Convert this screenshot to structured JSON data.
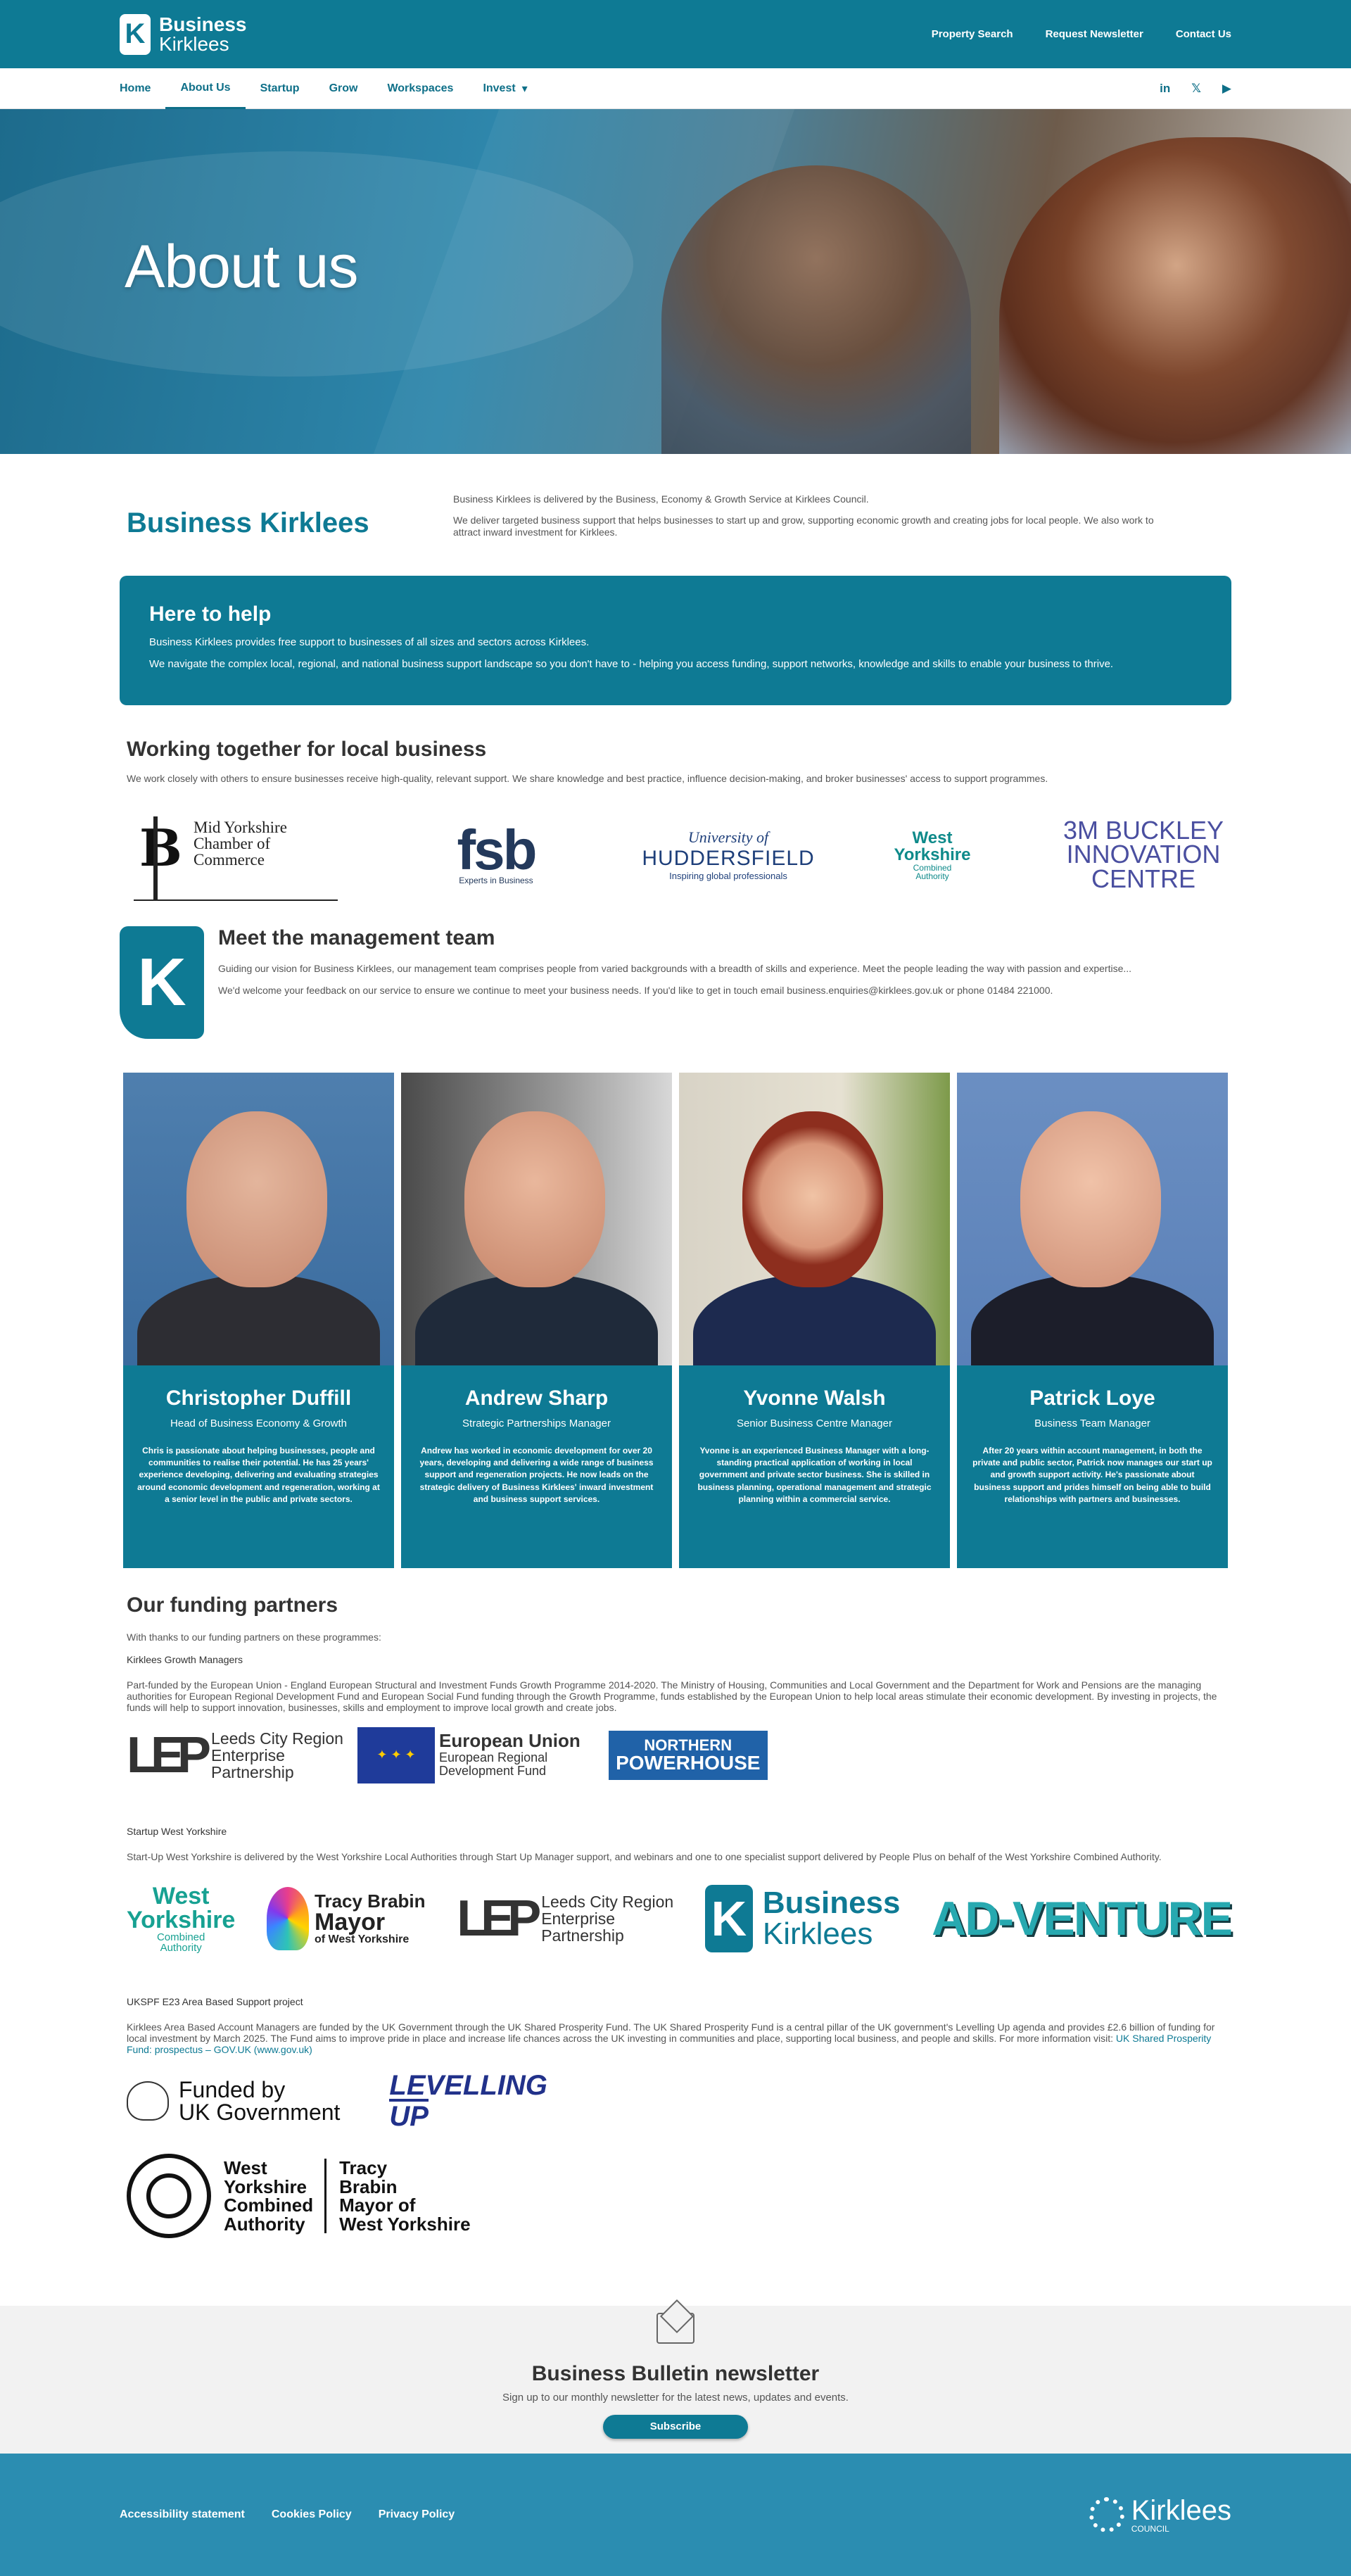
{
  "brand": {
    "line1": "Business",
    "line2": "Kirklees"
  },
  "top_links": [
    "Property Search",
    "Request Newsletter",
    "Contact Us"
  ],
  "nav": [
    "Home",
    "About Us",
    "Startup",
    "Grow",
    "Workspaces",
    "Invest"
  ],
  "nav_active": "About Us",
  "social": [
    "in",
    "𝕏",
    "▶"
  ],
  "hero": {
    "title": "About us"
  },
  "intro": {
    "heading": "Business Kirklees",
    "p1": "Business Kirklees is delivered by the Business, Economy & Growth Service at Kirklees Council.",
    "p2": "We deliver targeted business support that helps businesses to start up and grow, supporting economic growth and creating jobs for local people. We also work to attract inward investment for Kirklees."
  },
  "help": {
    "heading": "Here to help",
    "p1": "Business Kirklees provides free support to businesses of all sizes and sectors across Kirklees.",
    "p2": "We navigate the complex local, regional, and national business support landscape so you don't have to - helping you access funding, support networks, knowledge and skills to enable your business to thrive."
  },
  "working": {
    "heading": "Working together for local business",
    "text": "We work closely with others to ensure businesses receive high-quality, relevant support. We share knowledge and best practice, influence decision-making, and broker businesses' access to support programmes.",
    "logos": {
      "myc_line1": "Mid Yorkshire",
      "myc_line2": "Chamber of Commerce",
      "fsb": "fsb",
      "fsb_sub": "Experts in Business",
      "hud_a": "University of",
      "hud_b": "HUDDERSFIELD",
      "hud_c": "Inspiring global professionals",
      "wy_a": "West",
      "wy_b": "Yorkshire",
      "wy_c": "Combined",
      "wy_d": "Authority",
      "bk_a": "3M BUCKLEY",
      "bk_b": "INNOVATION",
      "bk_c": "CENTRE"
    }
  },
  "mgmt": {
    "heading": "Meet the management team",
    "p1": "Guiding our vision for Business Kirklees, our management team comprises people from varied backgrounds with a breadth of skills and experience. Meet the people leading the way with passion and expertise...",
    "p2": "We'd welcome your feedback on our service to ensure we continue to meet your business needs. If you'd like to get in touch email business.enquiries@kirklees.gov.uk or phone 01484 221000."
  },
  "team": [
    {
      "name": "Christopher Duffill",
      "role": "Head of Business Economy & Growth",
      "bio": "Chris is passionate about helping businesses, people and communities to realise their potential.  He has 25 years' experience developing, delivering and evaluating strategies around economic development and regeneration, working at a senior level in the public and private sectors."
    },
    {
      "name": "Andrew Sharp",
      "role": "Strategic Partnerships Manager",
      "bio": "Andrew has worked in economic development for over 20 years, developing and delivering a wide range of business support and regeneration projects. He now leads on the strategic delivery of Business Kirklees' inward investment and business support services."
    },
    {
      "name": "Yvonne Walsh",
      "role": "Senior Business Centre Manager",
      "bio": "Yvonne is an experienced Business Manager with a long-standing practical application of working in local government and private sector business. She is skilled in business planning, operational management and strategic planning within a commercial service."
    },
    {
      "name": "Patrick Loye",
      "role": "Business Team Manager",
      "bio": "After 20 years within account management, in both the private and public sector, Patrick now manages our start up and growth support activity. He's passionate about business support and prides himself on being able to build relationships with partners and businesses."
    }
  ],
  "funding": {
    "heading": "Our funding partners",
    "lead": "With thanks to our funding partners on these programmes:",
    "s1_title": "Kirklees Growth Managers",
    "s1_text": "Part-funded by the European Union - England European Structural and Investment Funds Growth Programme 2014-2020. The Ministry of Housing, Communities and Local Government and the Department for Work and Pensions are the managing authorities for European Regional Development Fund and European Social Fund funding through the Growth Programme, funds established by the European Union to help local areas stimulate their economic development. By investing in projects, the funds will help to support innovation, businesses, skills and employment to improve local growth and create jobs.",
    "lep_a": "Leeds City Region",
    "lep_b": "Enterprise",
    "lep_c": "Partnership",
    "eu_a": "European Union",
    "eu_b": "European Regional",
    "eu_c": "Development Fund",
    "np_a": "NORTHERN",
    "np_b": "POWERHOUSE",
    "s2_title": "Startup West Yorkshire",
    "s2_text": "Start-Up West Yorkshire is delivered by the West Yorkshire Local Authorities through Start Up Manager support, and webinars and one to one specialist support delivered by People Plus on behalf of the West Yorkshire Combined Authority.",
    "tb_a": "Tracy Brabin",
    "tb_b": "Mayor",
    "tb_c": "of West Yorkshire",
    "bk_a": "Business",
    "bk_b": "Kirklees",
    "adv": "AD-VENTURE",
    "s3_title": "UKSPF E23 Area Based Support project",
    "s3_text": "Kirklees Area Based Account Managers are funded by the UK Government through the UK Shared Prosperity Fund.  The UK Shared Prosperity Fund is a central pillar of the UK government's Levelling Up agenda and provides £2.6 billion of funding for local investment by March 2025. The Fund aims to improve pride in place and increase life chances across the UK investing in communities and place, supporting local business, and people and skills. For more information visit: ",
    "s3_link": "UK Shared Prosperity Fund: prospectus – GOV.UK (www.gov.uk)",
    "ukgov_a": "Funded by",
    "ukgov_b": "UK Government",
    "lup_a": "LEVELLING",
    "lup_b": "UP",
    "wyb_a": "West",
    "wyb_b": "Yorkshire",
    "wyb_c": "Combined",
    "wyb_d": "Authority",
    "wyb_e": "Tracy",
    "wyb_f": "Brabin",
    "wyb_g": "Mayor of",
    "wyb_h": "West Yorkshire"
  },
  "newsletter": {
    "heading": "Business Bulletin newsletter",
    "text": "Sign up to our monthly newsletter for the latest news, updates and events.",
    "button": "Subscribe"
  },
  "footer": {
    "links": [
      "Accessibility statement",
      "Cookies Policy",
      "Privacy Policy"
    ],
    "council_a": "Kirklees",
    "council_b": "COUNCIL"
  },
  "colors": {
    "primary": "#0e7a94",
    "footer": "#2b8db1",
    "newsletter_bg": "#f2f2f2"
  }
}
